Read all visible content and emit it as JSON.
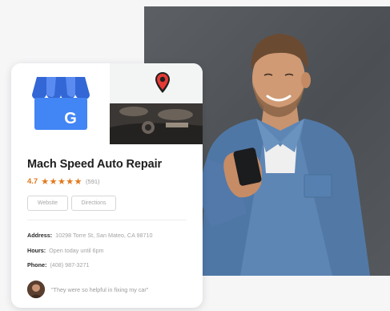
{
  "business": {
    "name": "Mach Speed Auto Repair",
    "rating": "4.7",
    "stars": "★★★★★",
    "review_count": "(591)"
  },
  "buttons": {
    "website": "Website",
    "directions": "Directions"
  },
  "info": {
    "address_label": "Address:",
    "address_value": "10298 Torre St, San Mateo, CA 98710",
    "hours_label": "Hours:",
    "hours_value": "Open today until 6pm",
    "phone_label": "Phone:",
    "phone_value": "(408) 987-3271"
  },
  "review": {
    "quote": "\"They were so helpful in fixing my car\""
  },
  "logo": {
    "letter": "G"
  },
  "colors": {
    "accent": "#e0791c",
    "logo_blue": "#4285f4",
    "logo_dark_blue": "#3367d6",
    "pin_red": "#e53935",
    "photo_wall": "#55595d",
    "shirt_denim": "#5d86b5"
  },
  "icons": {
    "logo": "google-my-business-storefront-icon",
    "map_pin": "map-pin-icon"
  }
}
